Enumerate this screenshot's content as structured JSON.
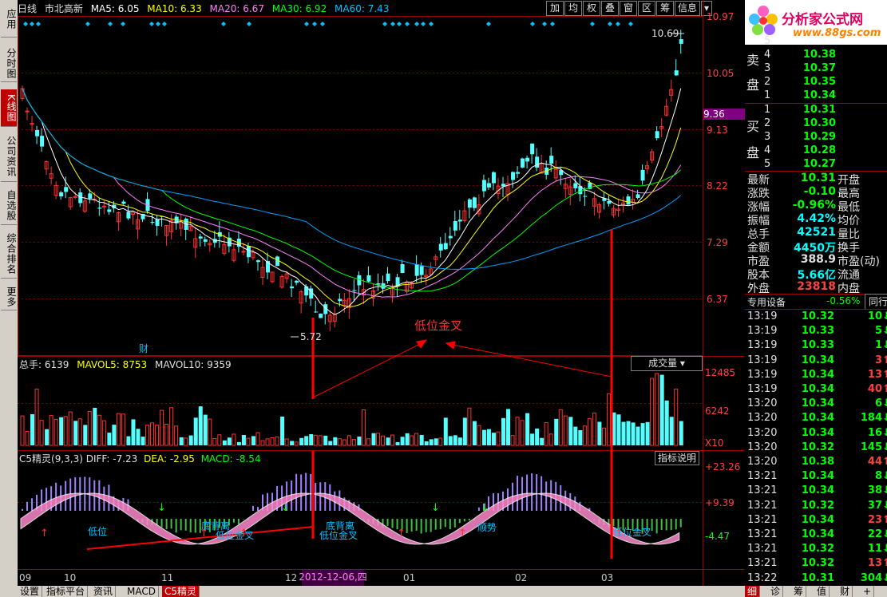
{
  "left_tabs": [
    "应用",
    "分时图",
    "K线图",
    "公司资讯",
    "自选股",
    "综合排名",
    "更多"
  ],
  "left_tab_active": "K线图",
  "info_bar": {
    "period": "日线",
    "stock": "市北高新",
    "ma5": "MA5: 6.05",
    "ma10": "MA10: 6.33",
    "ma20": "MA20: 6.67",
    "ma30": "MA30: 6.92",
    "ma60": "MA60: 7.43"
  },
  "toolbar": [
    "加",
    "均",
    "权",
    "叠",
    "窗",
    "区",
    "筹",
    "信息"
  ],
  "price_axis": [
    "10.97",
    "10.05",
    "9.36",
    "9.13",
    "8.22",
    "7.29",
    "6.37"
  ],
  "price_axis_current": "9.36",
  "annotations": {
    "high_label": "10.69",
    "low_label": "5.72",
    "finance_marker": "财",
    "cross_text": "低位金叉"
  },
  "volume_panel": {
    "title": "总手: 6139",
    "mavol5": "MAVOL5: 8753",
    "mavol10": "MAVOL10: 9359",
    "dropdown": "成交量",
    "axis": [
      "12485",
      "6242",
      "X10"
    ]
  },
  "indicator_panel": {
    "title": "C5精灵(9,3,3)",
    "diff": "DIFF: -7.23",
    "dea": "DEA: -2.95",
    "macd": "MACD: -8.54",
    "explain_button": "指标说明",
    "axis": [
      "+23.26",
      "+9.39",
      "-4.47"
    ],
    "labels": [
      "低位",
      "底背离",
      "低位金叉",
      "底背离",
      "低位金叉",
      "顺势",
      "低位金叉"
    ]
  },
  "date_axis": [
    "09",
    "10",
    "11",
    "12",
    "01",
    "02",
    "03"
  ],
  "date_cursor": "2012-12-06,四",
  "bottom_tabs": [
    "设置",
    "指标平台",
    "资讯",
    "MACD",
    "C5精灵"
  ],
  "bottom_tab_active": "C5精灵",
  "logo": {
    "title": "分析家公式网",
    "url": "www.88gs.com"
  },
  "order_book": {
    "sell_label": [
      "卖",
      "盘"
    ],
    "buy_label": [
      "买",
      "盘"
    ],
    "sell": [
      {
        "level": "5",
        "price": ""
      },
      {
        "level": "4",
        "price": "10.38"
      },
      {
        "level": "3",
        "price": "10.37"
      },
      {
        "level": "2",
        "price": "10.35"
      },
      {
        "level": "1",
        "price": "10.34"
      }
    ],
    "buy": [
      {
        "level": "1",
        "price": "10.31"
      },
      {
        "level": "2",
        "price": "10.30"
      },
      {
        "level": "3",
        "price": "10.29"
      },
      {
        "level": "4",
        "price": "10.28"
      },
      {
        "level": "5",
        "price": "10.27"
      }
    ]
  },
  "stats": [
    {
      "k": "最新",
      "v": "10.31",
      "k2": "开盘",
      "c": "#00ff00"
    },
    {
      "k": "涨跌",
      "v": "-0.10",
      "k2": "最高",
      "c": "#00ff00"
    },
    {
      "k": "涨幅",
      "v": "-0.96%",
      "k2": "最低",
      "c": "#00ff00"
    },
    {
      "k": "振幅",
      "v": "4.42%",
      "k2": "均价",
      "c": "#00ffff"
    },
    {
      "k": "总手",
      "v": "42521",
      "k2": "量比",
      "c": "#00ffff"
    },
    {
      "k": "金额",
      "v": "4450万",
      "k2": "换手",
      "c": "#00ffff"
    },
    {
      "k": "市盈",
      "v": "388.9",
      "k2": "市盈(动)",
      "c": "#e0e0e0"
    },
    {
      "k": "股本",
      "v": "5.66亿",
      "k2": "流通",
      "c": "#00ffff"
    },
    {
      "k": "外盘",
      "v": "23818",
      "k2": "内盘",
      "c": "#ff4040"
    }
  ],
  "sector": {
    "name": "专用设备",
    "change": "-0.56%",
    "tab": "同行"
  },
  "ticks": [
    {
      "t": "13:19",
      "p": "10.32",
      "v": "10",
      "f": "↓",
      "c": "#00ff00"
    },
    {
      "t": "13:19",
      "p": "10.33",
      "v": "5",
      "f": "↓",
      "c": "#00ff00"
    },
    {
      "t": "13:19",
      "p": "10.33",
      "v": "1",
      "f": "↓",
      "c": "#00ff00"
    },
    {
      "t": "13:19",
      "p": "10.34",
      "v": "3",
      "f": "↑",
      "c": "#ff4040"
    },
    {
      "t": "13:19",
      "p": "10.34",
      "v": "13",
      "f": "↑",
      "c": "#ff4040"
    },
    {
      "t": "13:19",
      "p": "10.34",
      "v": "40",
      "f": "↑",
      "c": "#ff4040"
    },
    {
      "t": "13:20",
      "p": "10.34",
      "v": "6",
      "f": "↓",
      "c": "#00ff00"
    },
    {
      "t": "13:20",
      "p": "10.34",
      "v": "184",
      "f": "↓",
      "c": "#00ff00"
    },
    {
      "t": "13:20",
      "p": "10.34",
      "v": "16",
      "f": "↓",
      "c": "#00ff00"
    },
    {
      "t": "13:20",
      "p": "10.32",
      "v": "145",
      "f": "↓",
      "c": "#00ff00"
    },
    {
      "t": "13:20",
      "p": "10.38",
      "v": "44",
      "f": "↑",
      "c": "#ff4040"
    },
    {
      "t": "13:21",
      "p": "10.34",
      "v": "8",
      "f": "↓",
      "c": "#00ff00"
    },
    {
      "t": "13:21",
      "p": "10.34",
      "v": "38",
      "f": "↓",
      "c": "#00ff00"
    },
    {
      "t": "13:21",
      "p": "10.32",
      "v": "37",
      "f": "↓",
      "c": "#00ff00"
    },
    {
      "t": "13:21",
      "p": "10.34",
      "v": "23",
      "f": "↑",
      "c": "#ff4040"
    },
    {
      "t": "13:21",
      "p": "10.34",
      "v": "22",
      "f": "↓",
      "c": "#00ff00"
    },
    {
      "t": "13:21",
      "p": "10.32",
      "v": "11",
      "f": "↓",
      "c": "#00ff00"
    },
    {
      "t": "13:21",
      "p": "10.32",
      "v": "13",
      "f": "↑",
      "c": "#ff4040"
    },
    {
      "t": "13:22",
      "p": "10.31",
      "v": "304",
      "f": "↓",
      "c": "#00ff00"
    }
  ],
  "bottom_right_tabs": [
    "细",
    "诊",
    "筹",
    "值",
    "财",
    "+"
  ]
}
